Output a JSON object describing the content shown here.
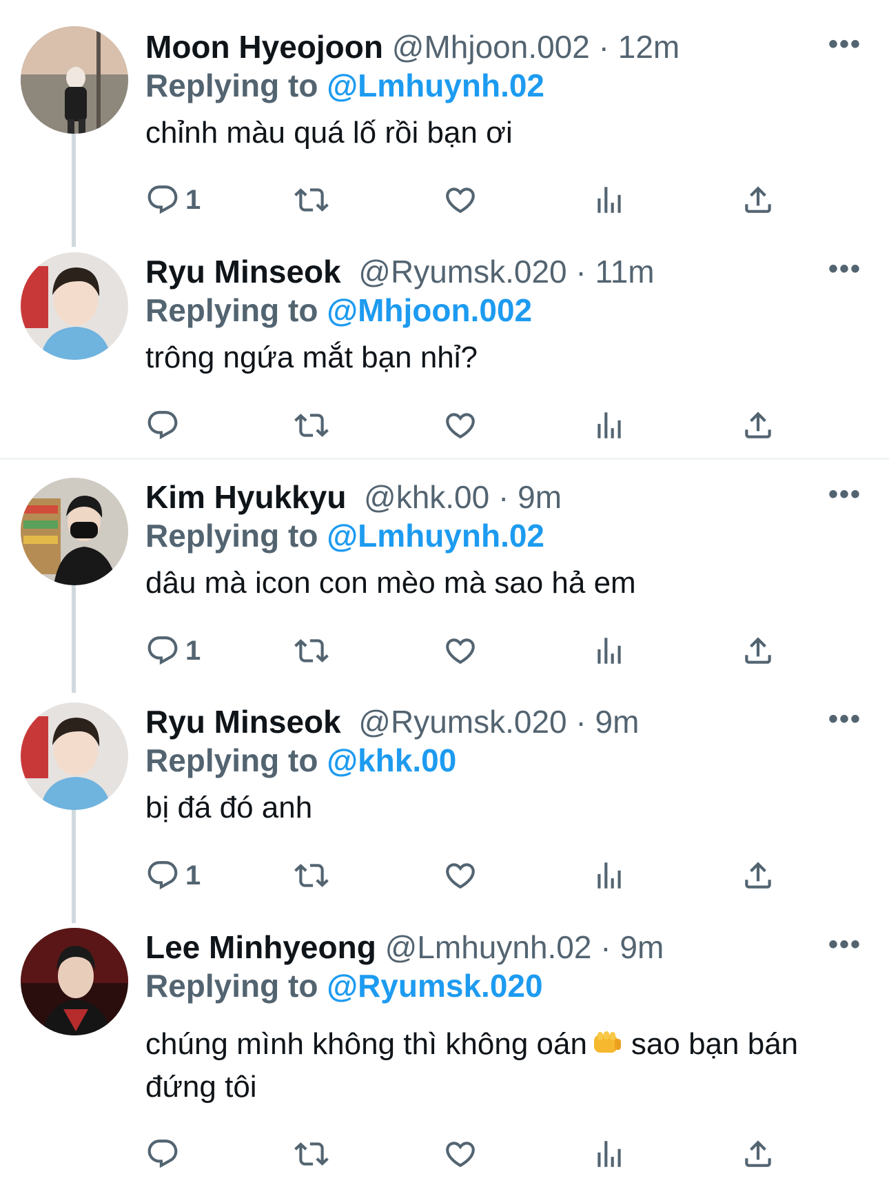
{
  "tweets": [
    {
      "name": "Moon Hyeojoon",
      "handle": "@Mhjoon.002",
      "time": "12m",
      "replying_label": "Replying to",
      "replying_to": "@Lmhuynh.02",
      "text": "chỉnh màu quá lố rồi bạn ơi",
      "reply_count": "1",
      "avatar_colors": [
        "#c9a98f",
        "#6e6a63"
      ]
    },
    {
      "name": "Ryu Minseok",
      "handle": "@Ryumsk.020",
      "time": "11m",
      "replying_label": "Replying to",
      "replying_to": "@Mhjoon.002",
      "text": "trông ngứa mắt bạn nhỉ?",
      "reply_count": "",
      "avatar_colors": [
        "#e9d7cf",
        "#6fb3df"
      ]
    },
    {
      "name": "Kim Hyukkyu",
      "handle": "@khk.00",
      "time": "9m",
      "replying_label": "Replying to",
      "replying_to": "@Lmhuynh.02",
      "text": "dâu mà icon con mèo mà sao hả em",
      "reply_count": "1",
      "avatar_colors": [
        "#d6d1c7",
        "#1b1b1b"
      ]
    },
    {
      "name": "Ryu Minseok",
      "handle": "@Ryumsk.020",
      "time": "9m",
      "replying_label": "Replying to",
      "replying_to": "@khk.00",
      "text": "bị đá đó anh",
      "reply_count": "1",
      "avatar_colors": [
        "#e9d7cf",
        "#6fb3df"
      ]
    },
    {
      "name": "Lee Minhyeong",
      "handle": "@Lmhuynh.02",
      "time": "9m",
      "replying_label": "Replying to",
      "replying_to": "@Ryumsk.020",
      "text_part1": "chúng mình không thì không oán",
      "text_part2": "sao bạn bán đứng tôi",
      "emoji_icon": "fist-emoji-icon",
      "reply_count": "",
      "avatar_colors": [
        "#5a1616",
        "#1a1a1a"
      ]
    }
  ],
  "icons": {
    "reply": "reply-icon",
    "retweet": "retweet-icon",
    "like": "heart-icon",
    "views": "views-icon",
    "share": "share-icon",
    "more": "more-icon"
  },
  "colors": {
    "link": "#1d9bf0",
    "secondary": "#536471",
    "thread_line": "#cfd9de"
  }
}
